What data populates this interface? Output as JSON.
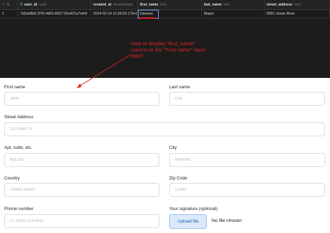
{
  "table": {
    "row_label": "1",
    "columns": [
      {
        "name": "user_id",
        "type": "uuid",
        "icon": "key-icon"
      },
      {
        "name": "created_at",
        "type": "timestamptz"
      },
      {
        "name": "first_name",
        "type": "text"
      },
      {
        "name": "last_name",
        "type": "text"
      },
      {
        "name": "street_address",
        "type": "text"
      }
    ],
    "row": {
      "user_id": "7d2a08b0-3f76-4d63-8027-92a421e7efe9",
      "created_at": "2024-02-14 11:56:53.179+00",
      "first_name": "Dawson",
      "last_name": "Mayer",
      "street_address": "8901 Janae River"
    }
  },
  "annotation": "How to display \"first_name\" column in the \"First name\" input field?",
  "form": {
    "first_name": {
      "label": "First name",
      "placeholder": "Jane"
    },
    "last_name": {
      "label": "Last name",
      "placeholder": "Doe"
    },
    "street": {
      "label": "Street Address",
      "placeholder": "123 Main St"
    },
    "apt": {
      "label": "Apt, suite, etc.",
      "placeholder": "Apt 101"
    },
    "city": {
      "label": "City",
      "placeholder": "Anytown"
    },
    "country": {
      "label": "Country",
      "placeholder": "United States"
    },
    "zip": {
      "label": "Zip Code",
      "placeholder": "12345"
    },
    "phone": {
      "label": "Phone number",
      "placeholder": "+1 (555) 123-4567"
    },
    "signature": {
      "label": "Your signature (optional)",
      "button": "Upload file",
      "status": "No file chosen"
    }
  },
  "colors": {
    "annotation": "#e02020",
    "accent": "#1a5fb4",
    "grid_bg": "#1c1c1c"
  }
}
